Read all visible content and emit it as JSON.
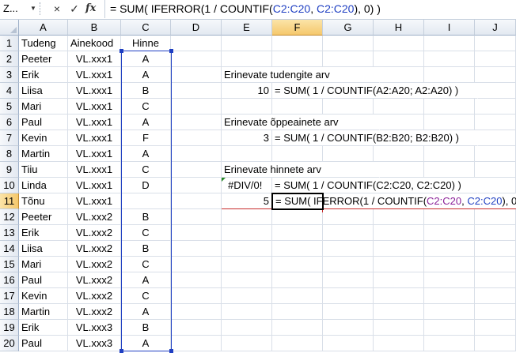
{
  "formula_bar": {
    "name_box": "Z...",
    "cancel_icon": "×",
    "enter_icon": "✓",
    "fx_label": "fx",
    "formula_prefix": "= SUM( IFERROR(1 / COUNTIF(",
    "formula_ref1": "C2:C20",
    "formula_sep": ", ",
    "formula_ref2": "C2:C20",
    "formula_suffix": "), 0) )"
  },
  "columns": [
    "A",
    "B",
    "C",
    "D",
    "E",
    "F",
    "G",
    "H",
    "I",
    "J"
  ],
  "selected_column": "F",
  "selected_row": "11",
  "rows": [
    "1",
    "2",
    "3",
    "4",
    "5",
    "6",
    "7",
    "8",
    "9",
    "10",
    "11",
    "12",
    "13",
    "14",
    "15",
    "16",
    "17",
    "18",
    "19",
    "20"
  ],
  "headers": {
    "a": "Tudeng",
    "b": "Ainekood",
    "c": "Hinne"
  },
  "students": [
    {
      "name": "Peeter",
      "code": "VL.xxx1",
      "grade": "A"
    },
    {
      "name": "Erik",
      "code": "VL.xxx1",
      "grade": "A"
    },
    {
      "name": "Liisa",
      "code": "VL.xxx1",
      "grade": "B"
    },
    {
      "name": "Mari",
      "code": "VL.xxx1",
      "grade": "C"
    },
    {
      "name": "Paul",
      "code": "VL.xxx1",
      "grade": "A"
    },
    {
      "name": "Kevin",
      "code": "VL.xxx1",
      "grade": "F"
    },
    {
      "name": "Martin",
      "code": "VL.xxx1",
      "grade": "A"
    },
    {
      "name": "Tiiu",
      "code": "VL.xxx1",
      "grade": "C"
    },
    {
      "name": "Linda",
      "code": "VL.xxx1",
      "grade": "D"
    },
    {
      "name": "Tõnu",
      "code": "VL.xxx1",
      "grade": ""
    },
    {
      "name": "Peeter",
      "code": "VL.xxx2",
      "grade": "B"
    },
    {
      "name": "Erik",
      "code": "VL.xxx2",
      "grade": "C"
    },
    {
      "name": "Liisa",
      "code": "VL.xxx2",
      "grade": "B"
    },
    {
      "name": "Mari",
      "code": "VL.xxx2",
      "grade": "C"
    },
    {
      "name": "Paul",
      "code": "VL.xxx2",
      "grade": "A"
    },
    {
      "name": "Kevin",
      "code": "VL.xxx2",
      "grade": "C"
    },
    {
      "name": "Martin",
      "code": "VL.xxx2",
      "grade": "A"
    },
    {
      "name": "Erik",
      "code": "VL.xxx3",
      "grade": "B"
    },
    {
      "name": "Paul",
      "code": "VL.xxx3",
      "grade": "A"
    }
  ],
  "summary": {
    "students_label": "Erinevate tudengite arv",
    "students_value": "10",
    "students_formula": "= SUM( 1 / COUNTIF(A2:A20; A2:A20) )",
    "courses_label": "Erinevate õppeainete arv",
    "courses_value": "3",
    "courses_formula": "= SUM( 1 / COUNTIF(B2:B20; B2:B20) )",
    "grades_label": "Erinevate hinnete arv",
    "grades_error": "#DIV/0!",
    "grades_formula": "= SUM( 1 / COUNTIF(C2:C20, C2:C20) )",
    "grades_value": "5",
    "edit_prefix": "= SUM( IFERROR(1 / COUNTIF(",
    "edit_ref1": "C2:C20",
    "edit_sep": ", ",
    "edit_ref2": "C2:C20",
    "edit_suffix": "), 0) )"
  }
}
